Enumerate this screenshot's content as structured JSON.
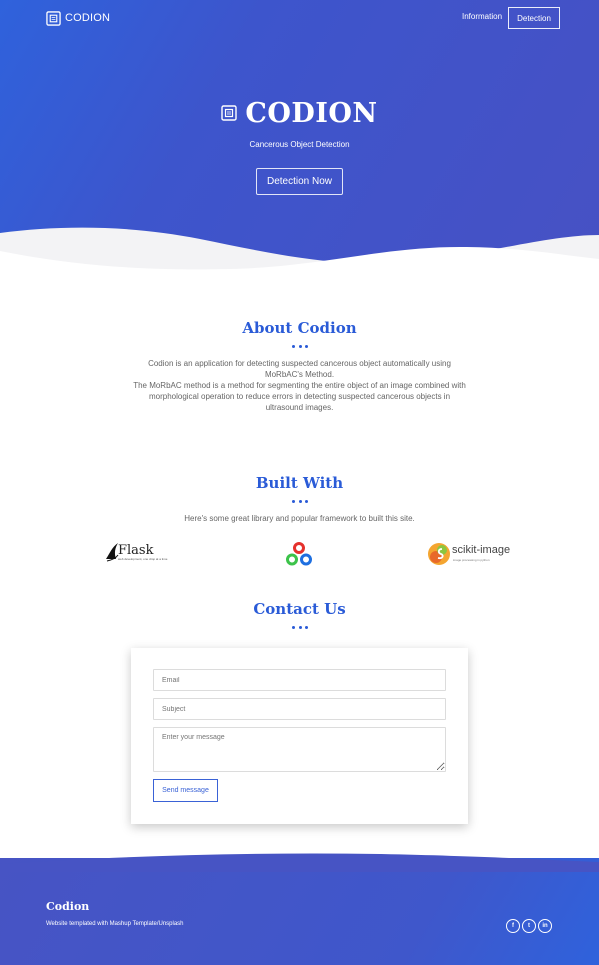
{
  "nav": {
    "brand": "CODION",
    "links": [
      {
        "label": "Information"
      },
      {
        "label": "Detection"
      }
    ]
  },
  "hero": {
    "title": "CODION",
    "subtitle": "Cancerous Object Detection",
    "cta": "Detection Now"
  },
  "about": {
    "title": "About Codion",
    "paragraphs": [
      "Codion is an application for detecting suspected cancerous object automatically using MoRbAC's Method.",
      "The MoRbAC method is a method for segmenting the entire object of an image combined with morphological operation to reduce errors in detecting suspected cancerous objects in ultrasound images."
    ]
  },
  "built": {
    "title": "Built With",
    "subtitle": "Here's some great library and popular framework to built this site.",
    "logos": [
      {
        "name": "Flask",
        "tagline": "web development, one drop at a time",
        "icon": "flask-logo-icon"
      },
      {
        "name": "OpenCV",
        "icon": "opencv-logo-icon"
      },
      {
        "name": "scikit-image",
        "tagline": "image processing in python",
        "icon": "scikit-image-logo-icon"
      }
    ]
  },
  "contact": {
    "title": "Contact Us",
    "fields": {
      "email_placeholder": "Email",
      "subject_placeholder": "Subject",
      "message_placeholder": "Enter your message"
    },
    "send_label": "Send message"
  },
  "footer": {
    "brand": "Codion",
    "credit": "Website templated with Mashup Template/Unsplash",
    "social": [
      {
        "label": "f",
        "icon": "facebook-icon"
      },
      {
        "label": "t",
        "icon": "twitter-icon"
      },
      {
        "label": "in",
        "icon": "linkedin-icon"
      }
    ]
  },
  "colors": {
    "accent": "#2a5bd7",
    "hero_start": "#2f62dc",
    "hero_end": "#4751c4",
    "footer": "#4754c4"
  }
}
